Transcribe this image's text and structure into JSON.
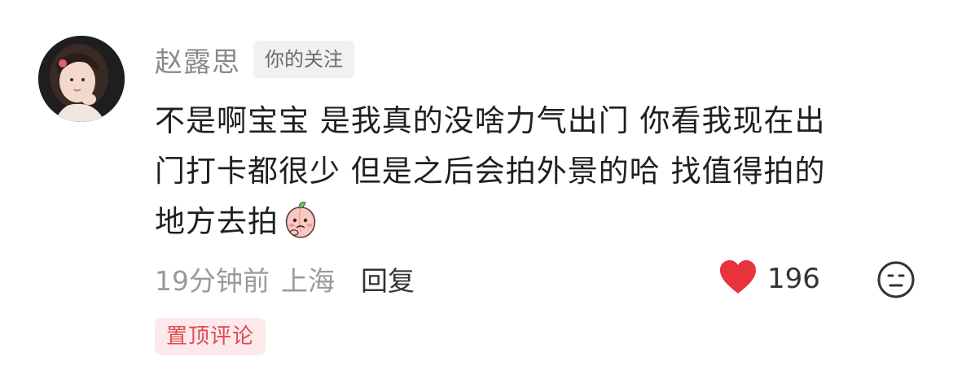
{
  "comment": {
    "author": "赵露思",
    "follow_badge": "你的关注",
    "text_lines": [
      "不是啊宝宝 是我真的没啥力气出门 你看我现在出",
      "门打卡都很少  但是之后会拍外景的哈 找值得拍的",
      "地方去拍"
    ],
    "emoji_icon": "peach-emoji-icon",
    "time": "19分钟前",
    "location": "上海",
    "reply_label": "回复",
    "like_icon": "heart-icon",
    "like_count": "196",
    "reaction_icon": "neutral-face-icon",
    "pinned_label": "置顶评论"
  },
  "colors": {
    "heart": "#e8323c",
    "pinned_text": "#e14a55",
    "pinned_bg": "#fde9ea",
    "muted_text": "#9a9a9a",
    "body_text": "#1f1f1f"
  }
}
